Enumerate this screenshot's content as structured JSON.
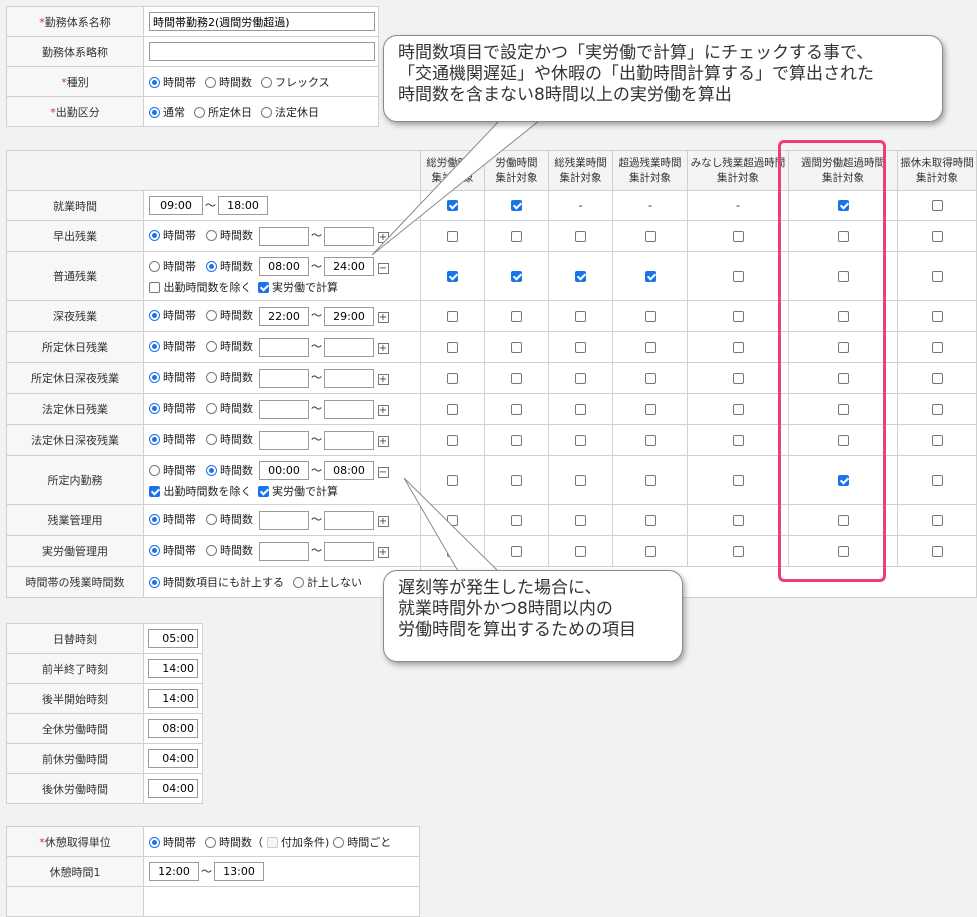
{
  "basic": {
    "name_label": "*勤務体系名称",
    "name_value": "時間帯勤務2(週間労働超過)",
    "short_label": "勤務体系略称",
    "short_value": "",
    "type_label": "*種別",
    "type_options": [
      "時間帯",
      "時間数",
      "フレックス"
    ],
    "type_selected": 0,
    "attend_label": "*出勤区分",
    "attend_options": [
      "通常",
      "所定休日",
      "法定休日"
    ],
    "attend_selected": 0
  },
  "matrix": {
    "columns": [
      "総労働時間\n集計対象",
      "労働時間\n集計対象",
      "総残業時間\n集計対象",
      "超過残業時間\n集計対象",
      "みなし残業超過時間\n集計対象",
      "週間労働超過時間\n集計対象",
      "振休未取得時間\n集計対象"
    ],
    "rows": [
      {
        "label": "就業時間",
        "kind": "plain",
        "from": "09:00",
        "to": "18:00",
        "checks": [
          "on",
          "on",
          "-",
          "-",
          "-",
          "on",
          "off"
        ]
      },
      {
        "label": "早出残業",
        "kind": "radio",
        "sel": 0,
        "from": "",
        "to": "",
        "pm": "⊞",
        "checks": [
          "off",
          "off",
          "off",
          "off",
          "off",
          "off",
          "off"
        ]
      },
      {
        "label": "普通残業",
        "kind": "radio2",
        "sel": 1,
        "from": "08:00",
        "to": "24:00",
        "pm": "⊟",
        "opt1": "出勤時間数を除く",
        "opt1_on": false,
        "opt2": "実労働で計算",
        "opt2_on": true,
        "checks": [
          "on",
          "on",
          "on",
          "on",
          "off",
          "off",
          "off"
        ]
      },
      {
        "label": "深夜残業",
        "kind": "radio",
        "sel": 0,
        "from": "22:00",
        "to": "29:00",
        "pm": "⊞",
        "checks": [
          "off",
          "off",
          "off",
          "off",
          "off",
          "off",
          "off"
        ]
      },
      {
        "label": "所定休日残業",
        "kind": "radio",
        "sel": 0,
        "from": "",
        "to": "",
        "pm": "⊞",
        "checks": [
          "off",
          "off",
          "off",
          "off",
          "off",
          "off",
          "off"
        ]
      },
      {
        "label": "所定休日深夜残業",
        "kind": "radio",
        "sel": 0,
        "from": "",
        "to": "",
        "pm": "⊞",
        "checks": [
          "off",
          "off",
          "off",
          "off",
          "off",
          "off",
          "off"
        ]
      },
      {
        "label": "法定休日残業",
        "kind": "radio",
        "sel": 0,
        "from": "",
        "to": "",
        "pm": "⊞",
        "checks": [
          "off",
          "off",
          "off",
          "off",
          "off",
          "off",
          "off"
        ]
      },
      {
        "label": "法定休日深夜残業",
        "kind": "radio",
        "sel": 0,
        "from": "",
        "to": "",
        "pm": "⊞",
        "checks": [
          "off",
          "off",
          "off",
          "off",
          "off",
          "off",
          "off"
        ]
      },
      {
        "label": "所定内勤務",
        "kind": "radio2",
        "sel": 1,
        "from": "00:00",
        "to": "08:00",
        "pm": "⊟",
        "opt1": "出勤時間数を除く",
        "opt1_on": true,
        "opt2": "実労働で計算",
        "opt2_on": true,
        "checks": [
          "off",
          "off",
          "off",
          "off",
          "off",
          "on",
          "off"
        ]
      },
      {
        "label": "残業管理用",
        "kind": "radio",
        "sel": 0,
        "from": "",
        "to": "",
        "pm": "⊞",
        "checks": [
          "off",
          "off",
          "off",
          "off",
          "off",
          "off",
          "off"
        ]
      },
      {
        "label": "実労働管理用",
        "kind": "radio",
        "sel": 0,
        "from": "",
        "to": "",
        "pm": "⊞",
        "checks": [
          "off",
          "off",
          "off",
          "off",
          "off",
          "off",
          "off"
        ]
      },
      {
        "label": "時間帯の残業時間数",
        "kind": "count",
        "options": [
          "時間数項目にも計上する",
          "計上しない"
        ],
        "sel": 0,
        "checks": []
      }
    ],
    "range_options": [
      "時間帯",
      "時間数"
    ],
    "tilde": "〜"
  },
  "day": {
    "rows": [
      {
        "label": "日替時刻",
        "value": "05:00"
      },
      {
        "label": "前半終了時刻",
        "value": "14:00"
      },
      {
        "label": "後半開始時刻",
        "value": "14:00"
      },
      {
        "label": "全休労働時間",
        "value": "08:00"
      },
      {
        "label": "前休労働時間",
        "value": "04:00"
      },
      {
        "label": "後休労働時間",
        "value": "04:00"
      }
    ]
  },
  "breaks": {
    "unit_label": "*休憩取得単位",
    "unit_opt1": "時間帯",
    "unit_opt2": "時間数（",
    "unit_extra": "付加条件)",
    "unit_opt3": "時間ごと",
    "break1_label": "休憩時間1",
    "break1_from": "12:00",
    "break1_to": "13:00"
  },
  "callouts": {
    "top": [
      "時間数項目で設定かつ「実労働で計算」にチェックする事で、",
      "「交通機関遅延」や休暇の「出勤時間計算する」で算出された",
      "時間数を含まない8時間以上の実労働を算出"
    ],
    "bottom": [
      "遅刻等が発生した場合に、",
      "就業時間外かつ8時間以内の",
      "労働時間を算出するための項目"
    ]
  },
  "colors": {
    "accent": "#1a73e8",
    "highlight": "#ee3e73",
    "required": "#e0245e"
  }
}
